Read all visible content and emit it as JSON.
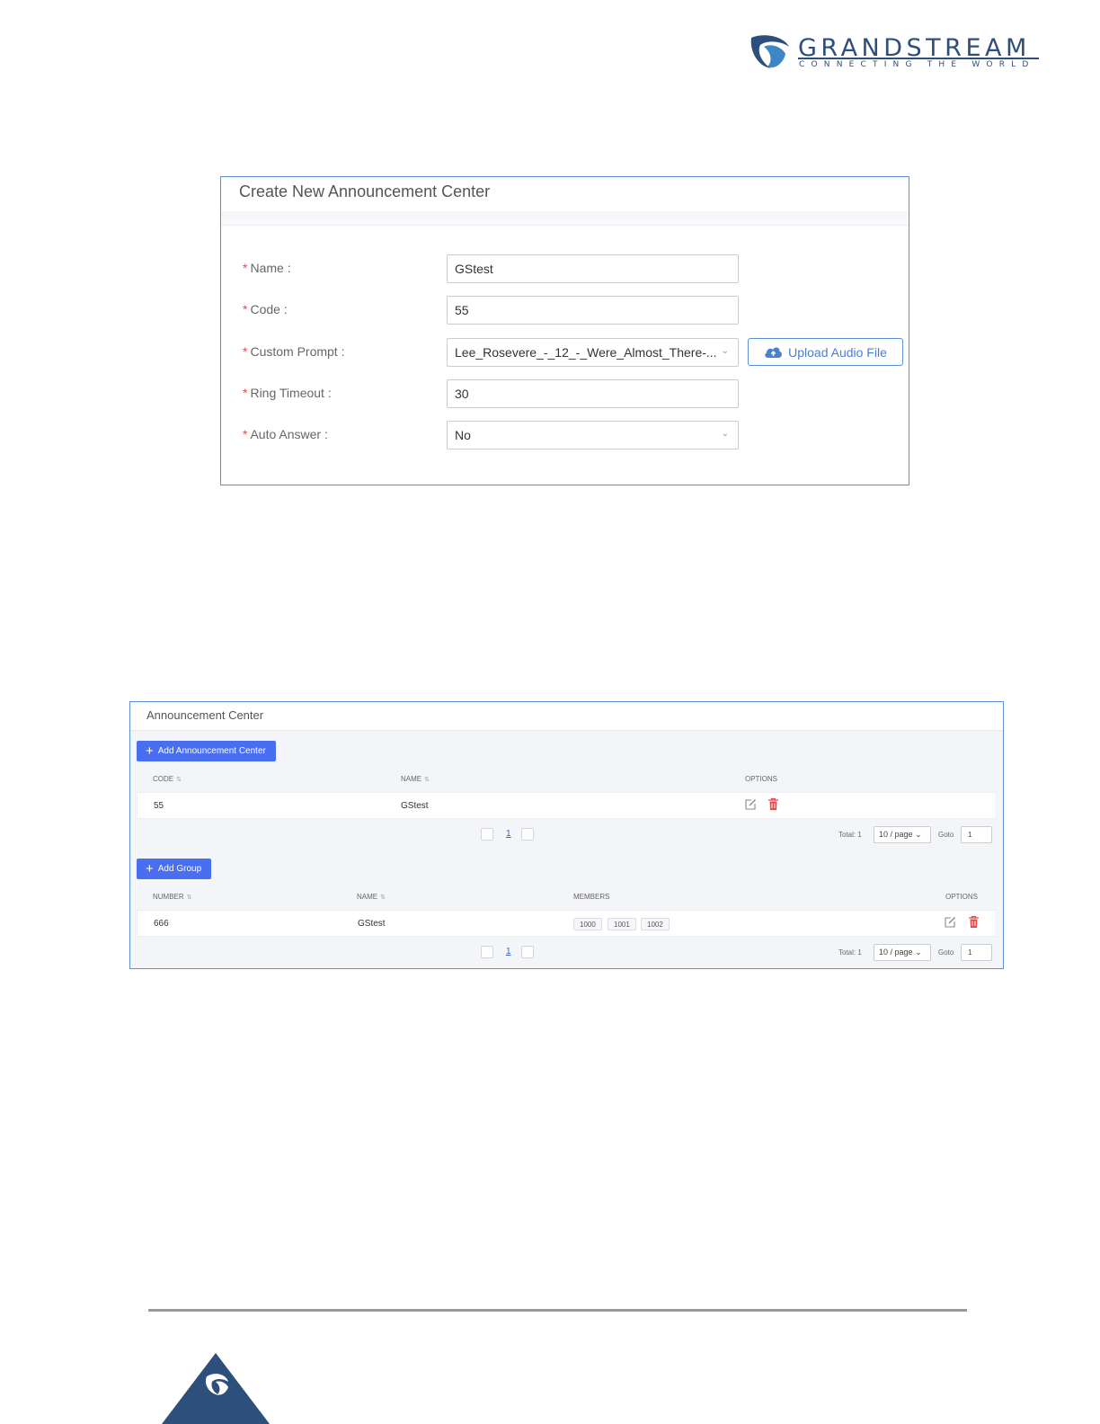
{
  "logo": {
    "name": "GRANDSTREAM",
    "tagline": "CONNECTING THE WORLD"
  },
  "create_dialog": {
    "title": "Create New Announcement Center",
    "fields": [
      {
        "label": "Name",
        "value": "GStest",
        "type": "text"
      },
      {
        "label": "Code",
        "value": "55",
        "type": "text"
      },
      {
        "label": "Custom Prompt",
        "value": "Lee_Rosevere_-_12_-_Were_Almost_There-...",
        "type": "select"
      },
      {
        "label": "Ring Timeout",
        "value": "30",
        "type": "text"
      },
      {
        "label": "Auto Answer",
        "value": "No",
        "type": "select"
      }
    ],
    "upload_label": "Upload Audio File"
  },
  "announcement_center": {
    "title": "Announcement Center",
    "add_button": "Add Announcement Center",
    "columns": [
      "CODE",
      "NAME",
      "OPTIONS"
    ],
    "rows": [
      {
        "code": "55",
        "name": "GStest"
      }
    ],
    "pagination": {
      "page": "1",
      "total": "Total: 1",
      "per_page": "10 / page",
      "goto_label": "Goto",
      "goto_value": "1"
    }
  },
  "groups": {
    "add_button": "Add Group",
    "columns": [
      "NUMBER",
      "NAME",
      "MEMBERS",
      "OPTIONS"
    ],
    "rows": [
      {
        "number": "666",
        "name": "GStest",
        "members": [
          "1000",
          "1001",
          "1002"
        ]
      }
    ],
    "pagination": {
      "page": "1",
      "total": "Total: 1",
      "per_page": "10 / page",
      "goto_label": "Goto",
      "goto_value": "1"
    }
  },
  "colors": {
    "accent": "#4a6ef0",
    "panel_border": "#5b8fd6",
    "required": "#e8484a",
    "delete": "#e8484a",
    "brand": "#2d4f7c"
  },
  "icons": [
    "grandstream-logo-icon",
    "cloud-upload-icon",
    "chevron-down-icon",
    "plus-icon",
    "sort-icon",
    "edit-icon",
    "delete-icon"
  ]
}
